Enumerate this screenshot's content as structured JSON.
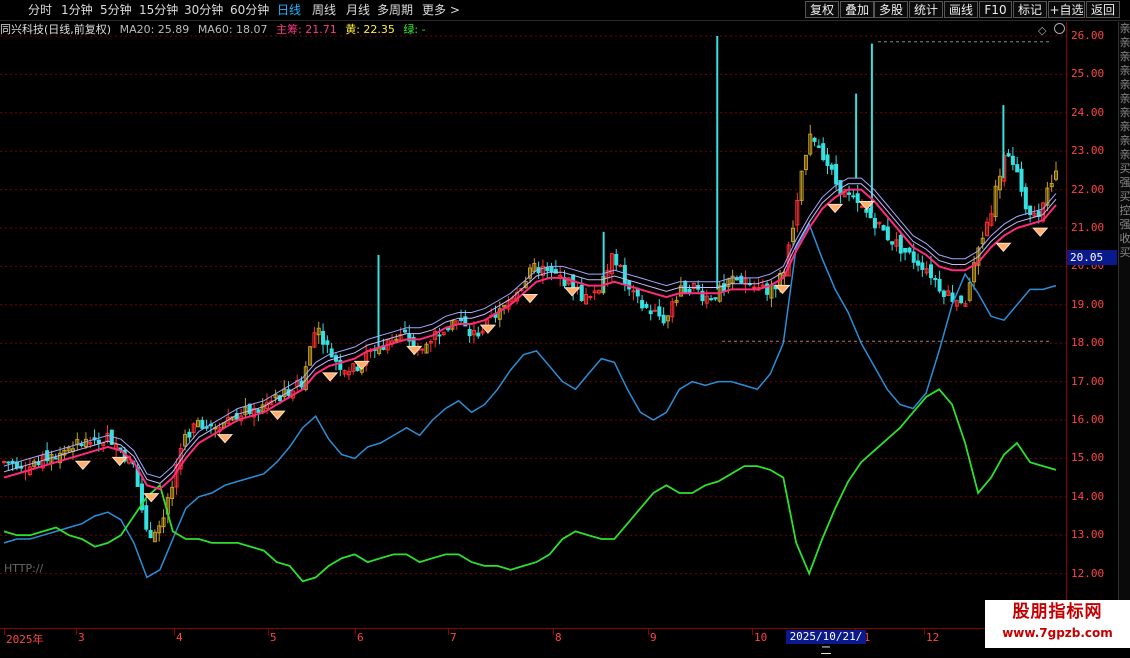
{
  "toolbar": {
    "periods": [
      {
        "label": "分时",
        "active": false
      },
      {
        "label": "1分钟",
        "active": false
      },
      {
        "label": "5分钟",
        "active": false
      },
      {
        "label": "15分钟",
        "active": false
      },
      {
        "label": "30分钟",
        "active": false
      },
      {
        "label": "60分钟",
        "active": false
      },
      {
        "label": "日线",
        "active": true
      },
      {
        "label": "周线",
        "active": false
      },
      {
        "label": "月线",
        "active": false
      },
      {
        "label": "多周期",
        "active": false
      },
      {
        "label": "更多 >",
        "active": false
      }
    ],
    "right_buttons": [
      "复权",
      "叠加",
      "多股",
      "统计",
      "画线",
      "F10",
      "标记",
      "+自选",
      "返回"
    ]
  },
  "info": {
    "title": "同兴科技(日线,前复权)",
    "ma20": "MA20: 25.89",
    "ma60": "MA60: 18.07",
    "main": "主筹: 21.71",
    "yellow": "黄: 22.35",
    "green": "绿: -"
  },
  "price_axis": {
    "labels": [
      "26.00",
      "25.00",
      "24.00",
      "23.00",
      "22.00",
      "21.00",
      "20.00",
      "19.00",
      "18.00",
      "17.00",
      "16.00",
      "15.00",
      "14.00",
      "13.00",
      "12.00"
    ],
    "current_price": "20.05"
  },
  "date_axis": {
    "labels": [
      "2025年",
      "3",
      "4",
      "5",
      "6",
      "7",
      "8",
      "9",
      "10",
      "11",
      "12"
    ],
    "highlight": "2025/10/21/二"
  },
  "side_strip": "亲亲亲亲亲亲亲亲亲亲买强买控强收买",
  "http_label": "HTTP://",
  "watermark": {
    "title": "股朋指标网",
    "url": "www.7gpzb.com"
  },
  "colors": {
    "up": "#ff3030",
    "down": "#35e0e0",
    "ma_line": "#ff2a7a",
    "blue_line": "#2a8fd8",
    "green_line": "#2ee02e",
    "gold_candle": "#c8a020",
    "lavender": "#c8b8ff"
  },
  "chart_data": {
    "type": "line",
    "ylim": [
      11.5,
      26.2
    ],
    "series": [
      {
        "values": [
          14.9,
          14.9,
          14.8,
          15.0,
          15.1,
          15.3,
          15.4,
          15.5,
          15.6,
          15.2,
          14.8,
          13.0,
          13.3,
          14.3,
          15.6,
          16.0,
          15.8,
          16.0,
          16.2,
          16.2,
          16.3,
          16.6,
          16.8,
          17.0,
          18.6,
          17.8,
          17.4,
          17.3,
          17.8,
          17.9,
          18.1,
          18.2,
          17.7,
          18.2,
          18.5,
          18.6,
          18.2,
          18.4,
          18.7,
          19.2,
          19.6,
          20.0,
          19.8,
          19.7,
          19.4,
          19.1,
          19.6,
          20.3,
          19.4,
          19.0,
          18.8,
          18.6,
          19.4,
          19.5,
          19.2,
          19.3,
          19.6,
          19.7,
          19.4,
          19.4,
          19.8,
          21.4,
          23.6,
          23.0,
          22.2,
          21.8,
          21.5,
          21.2,
          20.8,
          20.5,
          20.2,
          20.0,
          19.5,
          19.2,
          19.1,
          20.4,
          21.5,
          22.9,
          22.4,
          21.2,
          21.6,
          22.4
        ]
      },
      {
        "values": [
          14.5,
          14.6,
          14.7,
          14.8,
          14.9,
          15.0,
          15.1,
          15.2,
          15.3,
          15.2,
          14.9,
          14.3,
          14.2,
          14.5,
          15.0,
          15.4,
          15.6,
          15.8,
          16.0,
          16.1,
          16.2,
          16.4,
          16.6,
          16.8,
          17.2,
          17.4,
          17.5,
          17.6,
          17.8,
          17.9,
          18.0,
          18.1,
          18.1,
          18.2,
          18.4,
          18.5,
          18.5,
          18.6,
          18.8,
          19.0,
          19.3,
          19.6,
          19.7,
          19.7,
          19.6,
          19.5,
          19.5,
          19.6,
          19.5,
          19.4,
          19.3,
          19.2,
          19.3,
          19.3,
          19.3,
          19.3,
          19.4,
          19.4,
          19.4,
          19.5,
          19.7,
          20.4,
          21.0,
          21.5,
          21.8,
          22.0,
          22.0,
          21.7,
          21.3,
          20.9,
          20.5,
          20.3,
          20.0,
          19.9,
          19.9,
          20.1,
          20.5,
          20.8,
          21.0,
          21.1,
          21.2,
          21.6
        ]
      },
      {
        "values": [
          12.8,
          12.9,
          12.9,
          13.0,
          13.1,
          13.2,
          13.3,
          13.5,
          13.6,
          13.4,
          12.8,
          11.9,
          12.1,
          12.9,
          13.7,
          14.0,
          14.1,
          14.3,
          14.4,
          14.5,
          14.6,
          14.9,
          15.3,
          15.8,
          16.1,
          15.5,
          15.1,
          15.0,
          15.3,
          15.4,
          15.6,
          15.8,
          15.6,
          16.0,
          16.3,
          16.5,
          16.2,
          16.4,
          16.8,
          17.3,
          17.7,
          17.8,
          17.4,
          17.0,
          16.8,
          17.2,
          17.6,
          17.5,
          16.8,
          16.2,
          16.0,
          16.2,
          16.8,
          17.0,
          16.9,
          17.0,
          17.0,
          16.9,
          16.8,
          17.2,
          18.0,
          20.5,
          21.1,
          20.2,
          19.4,
          18.8,
          18.0,
          17.4,
          16.8,
          16.4,
          16.3,
          16.7,
          17.8,
          19.0,
          19.8,
          19.3,
          18.7,
          18.6,
          19.0,
          19.4,
          19.4,
          19.5
        ]
      },
      {
        "values": [
          13.1,
          13.0,
          13.0,
          13.1,
          13.2,
          13.0,
          12.9,
          12.7,
          12.8,
          13.0,
          13.5,
          14.0,
          14.3,
          13.1,
          12.9,
          12.9,
          12.8,
          12.8,
          12.8,
          12.7,
          12.6,
          12.3,
          12.2,
          11.8,
          11.9,
          12.2,
          12.4,
          12.5,
          12.3,
          12.4,
          12.5,
          12.5,
          12.3,
          12.4,
          12.5,
          12.5,
          12.3,
          12.2,
          12.2,
          12.1,
          12.2,
          12.3,
          12.5,
          12.9,
          13.1,
          13.0,
          12.9,
          12.9,
          13.3,
          13.7,
          14.1,
          14.3,
          14.1,
          14.1,
          14.3,
          14.4,
          14.6,
          14.8,
          14.8,
          14.7,
          14.5,
          12.8,
          12.0,
          12.9,
          13.7,
          14.4,
          14.9,
          15.2,
          15.5,
          15.8,
          16.2,
          16.6,
          16.8,
          16.4,
          15.4,
          14.1,
          14.5,
          15.1,
          15.4,
          14.9,
          14.8,
          14.7
        ]
      }
    ]
  }
}
